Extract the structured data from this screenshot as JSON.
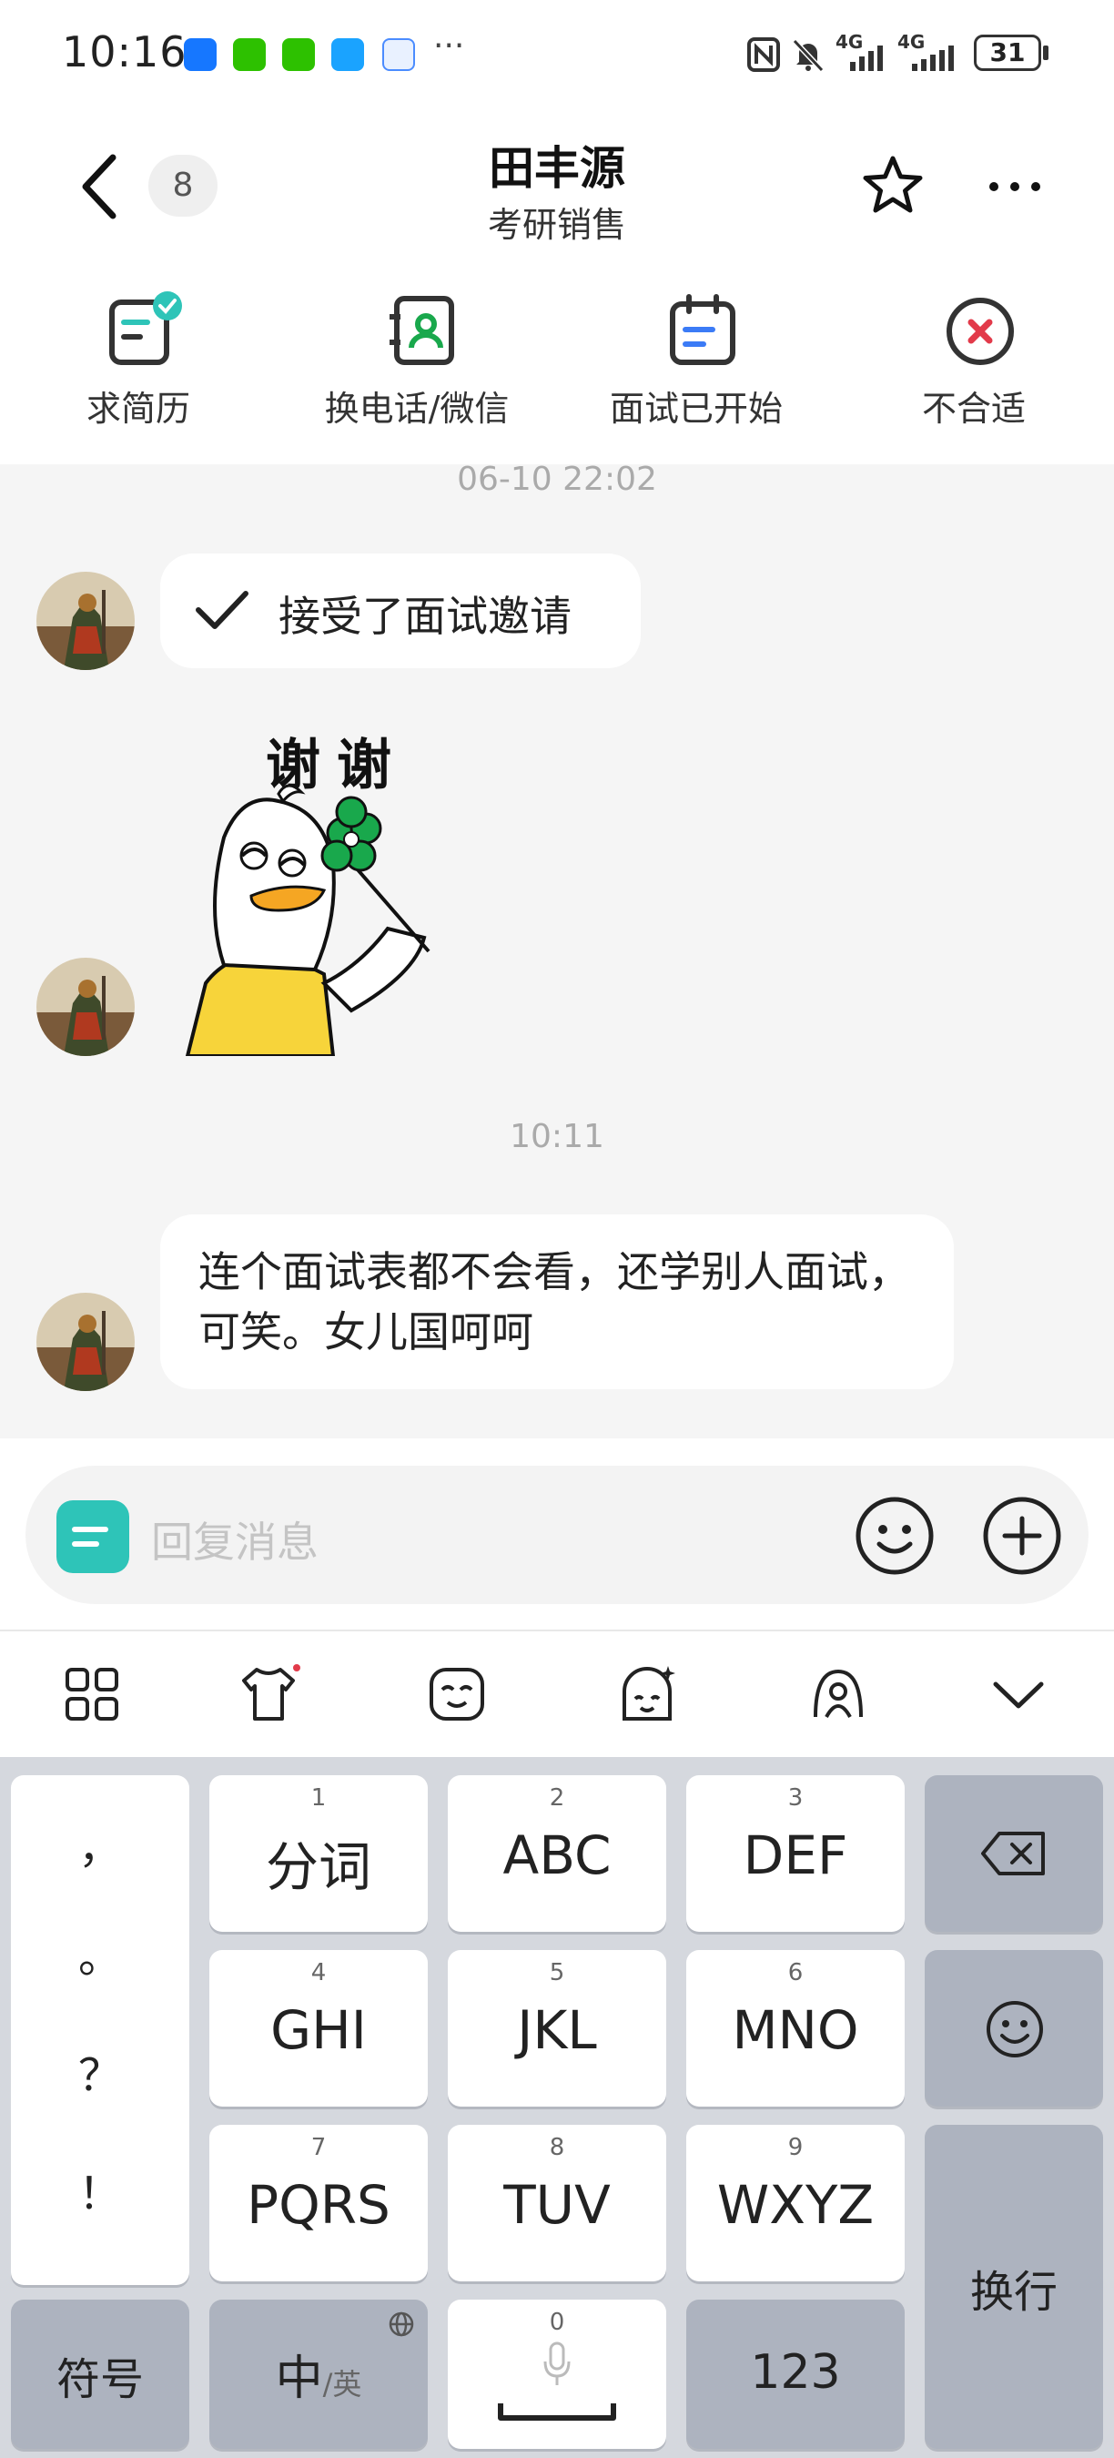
{
  "status_bar": {
    "time": "10:16",
    "more": "···",
    "battery": "31",
    "signal1": "4G",
    "signal2": "4G"
  },
  "header": {
    "unread_count": "8",
    "name": "田丰源",
    "job_title": "考研销售"
  },
  "actions": [
    {
      "label": "求简历",
      "icon": "resume-check-icon"
    },
    {
      "label": "换电话/微信",
      "icon": "contact-book-icon"
    },
    {
      "label": "面试已开始",
      "icon": "calendar-icon"
    },
    {
      "label": "不合适",
      "icon": "reject-x-icon"
    }
  ],
  "chat": {
    "timestamp1": "06-10 22:02",
    "message1": "接受了面试邀请",
    "sticker_text": "谢谢",
    "timestamp2": "10:11",
    "message3": "连个面试表都不会看，还学别人面试，可笑。女儿国呵呵"
  },
  "input": {
    "placeholder": "回复消息"
  },
  "keyboard": {
    "left_column": [
      "，",
      "。",
      "？",
      "！"
    ],
    "rows": [
      [
        {
          "num": "1",
          "label": "分词"
        },
        {
          "num": "2",
          "label": "ABC"
        },
        {
          "num": "3",
          "label": "DEF"
        }
      ],
      [
        {
          "num": "4",
          "label": "GHI"
        },
        {
          "num": "5",
          "label": "JKL"
        },
        {
          "num": "6",
          "label": "MNO"
        }
      ],
      [
        {
          "num": "7",
          "label": "PQRS"
        },
        {
          "num": "8",
          "label": "TUV"
        },
        {
          "num": "9",
          "label": "WXYZ"
        }
      ]
    ],
    "symbols": "符号",
    "lang_main": "中",
    "lang_sub": "/英",
    "space_num": "0",
    "numbers": "123",
    "enter": "换行"
  },
  "colors": {
    "teal": "#2ec4b8",
    "reject_red": "#e23a4a",
    "sticker_yellow": "#f7d43a",
    "clover_green": "#19a84c"
  }
}
